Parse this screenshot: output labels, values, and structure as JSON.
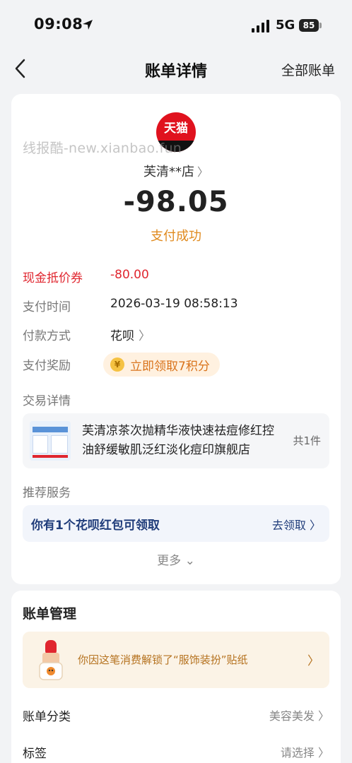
{
  "status_bar": {
    "time": "09:08",
    "network": "5G",
    "battery": "85"
  },
  "nav": {
    "title": "账单详情",
    "right_action": "全部账单"
  },
  "merchant": {
    "logo_text": "天猫",
    "name": "芙清**店",
    "amount": "-98.05",
    "status": "支付成功",
    "watermark": "线报酷-new.xianbao.fun"
  },
  "details": {
    "coupon_label": "现金抵价券",
    "coupon_value": "-80.00",
    "time_label": "支付时间",
    "time_value": "2026-03-19 08:58:13",
    "method_label": "付款方式",
    "method_value": "花呗",
    "reward_label": "支付奖励",
    "reward_value": "立即领取7积分"
  },
  "trade": {
    "section_label": "交易详情",
    "product_name": "芙清凉茶次抛精华液快速祛痘修红控油舒缓敏肌泛红淡化痘印旗舰店",
    "count": "共1件"
  },
  "service": {
    "section_label": "推荐服务",
    "text": "你有1个花呗红包可领取",
    "action": "去领取"
  },
  "more_label": "更多",
  "management": {
    "title": "账单管理",
    "sticker_text": "你因这笔消费解锁了“服饰装扮”贴纸",
    "category_label": "账单分类",
    "category_value": "美容美发",
    "tag_label": "标签",
    "tag_value": "请选择"
  },
  "colors": {
    "accent_orange": "#e08a1e",
    "coupon_red": "#e0262f",
    "service_blue": "#1f3c7a",
    "tmall_red": "#e0121e"
  }
}
